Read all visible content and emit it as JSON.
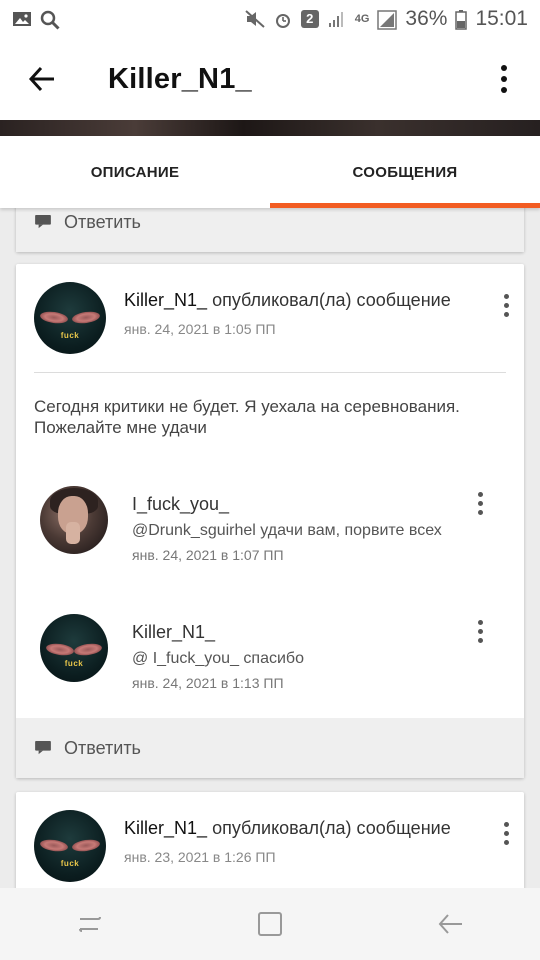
{
  "status_bar": {
    "battery": "36%",
    "time": "15:01",
    "network": "4G",
    "notification_count": "2"
  },
  "app_bar": {
    "title": "Killer_N1_"
  },
  "tabs": [
    {
      "label": "ОПИСАНИЕ",
      "active": false
    },
    {
      "label": "СООБЩЕНИЯ",
      "active": true
    }
  ],
  "accent_color": "#f25c22",
  "reply_label": "Ответить",
  "posts": [
    {
      "author": "Killer_N1_",
      "action": "опубликовал(ла) сообщение",
      "time": "янв. 24, 2021 в 1:05 ПП",
      "body_line1": "Сегодня критики не будет. Я уехала на серевнования.",
      "body_line2": "Пожелайте мне удачи",
      "avatar_tag": "fuck",
      "comments": [
        {
          "author": "I_fuck_you_",
          "text": "@Drunk_sguirhel удачи вам, порвите всех",
          "time": "янв. 24, 2021 в 1:07 ПП"
        },
        {
          "author": "Killer_N1_",
          "text": "@ I_fuck_you_  спасибо",
          "time": "янв. 24, 2021 в 1:13 ПП",
          "avatar_tag": "fuck"
        }
      ]
    },
    {
      "author": "Killer_N1_",
      "action": "опубликовал(ла) сообщение",
      "time": "янв. 23, 2021 в 1:26 ПП",
      "avatar_tag": "fuck"
    }
  ]
}
